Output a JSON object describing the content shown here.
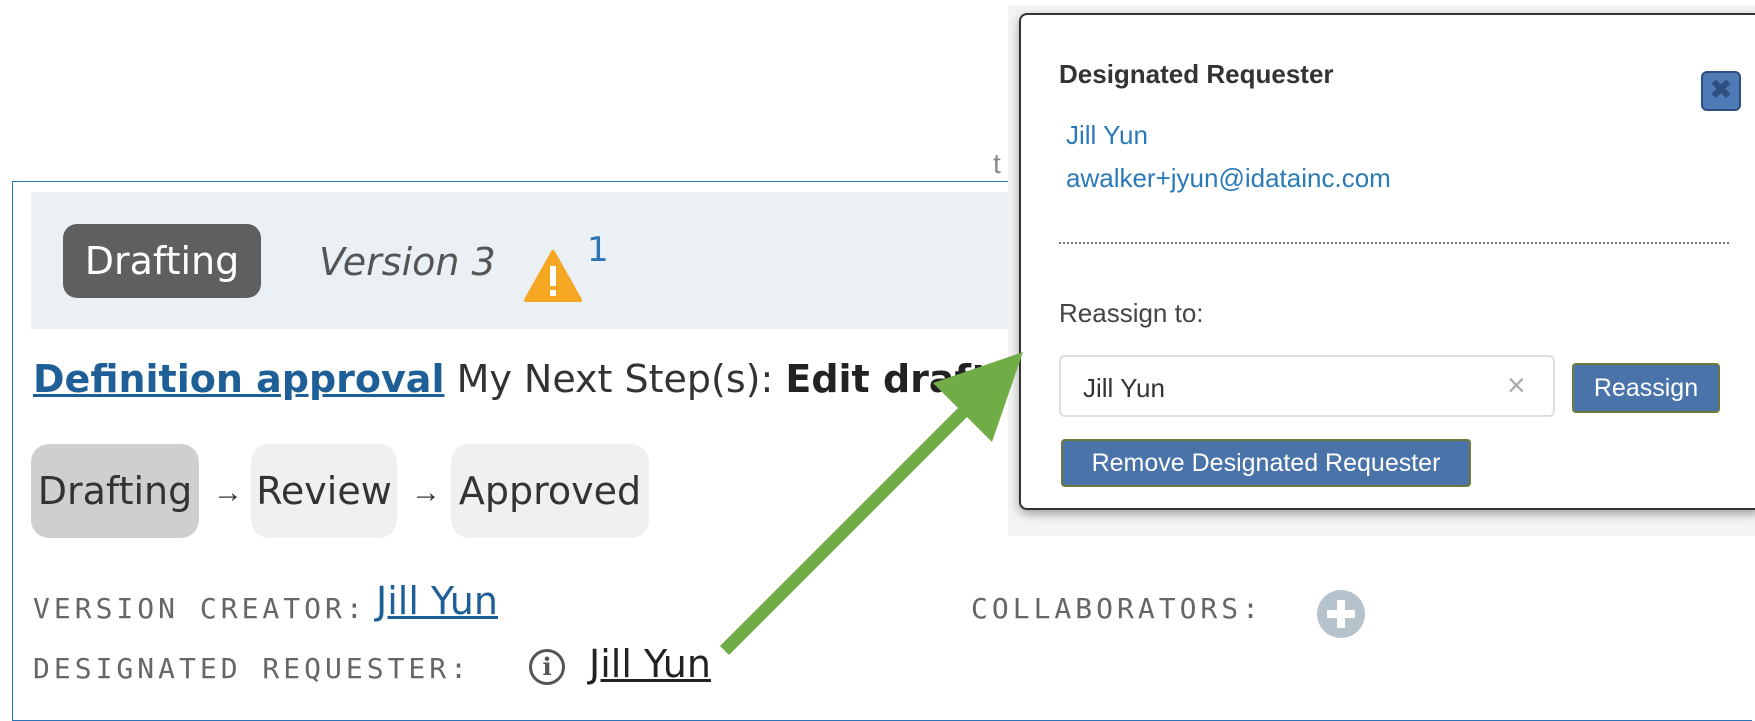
{
  "status": {
    "badge": "Drafting",
    "version": "Version 3",
    "warning_count": "1"
  },
  "steps": {
    "link": "Definition approval",
    "prefix": "My Next Step(s): ",
    "current": "Edit draft"
  },
  "workflow": {
    "stages": [
      "Drafting",
      "Review",
      "Approved"
    ],
    "arrow": "→"
  },
  "meta": {
    "version_creator_label": "VERSION CREATOR:",
    "version_creator": "Jill Yun",
    "collaborators_label": "COLLABORATORS:",
    "designated_requester_label": "DESIGNATED REQUESTER:",
    "designated_requester": "Jill Yun"
  },
  "hidden_char": "t",
  "popup": {
    "title": "Designated Requester",
    "name": "Jill Yun",
    "email": "awalker+jyun@idatainc.com",
    "reassign_label": "Reassign to:",
    "input_value": "Jill Yun",
    "clear_glyph": "×",
    "reassign_button": "Reassign",
    "remove_button": "Remove Designated Requester",
    "close_glyph": "✖"
  },
  "colors": {
    "accent": "#2e75b6",
    "arrow_green": "#70ad47",
    "button_blue": "#4a73a9"
  }
}
